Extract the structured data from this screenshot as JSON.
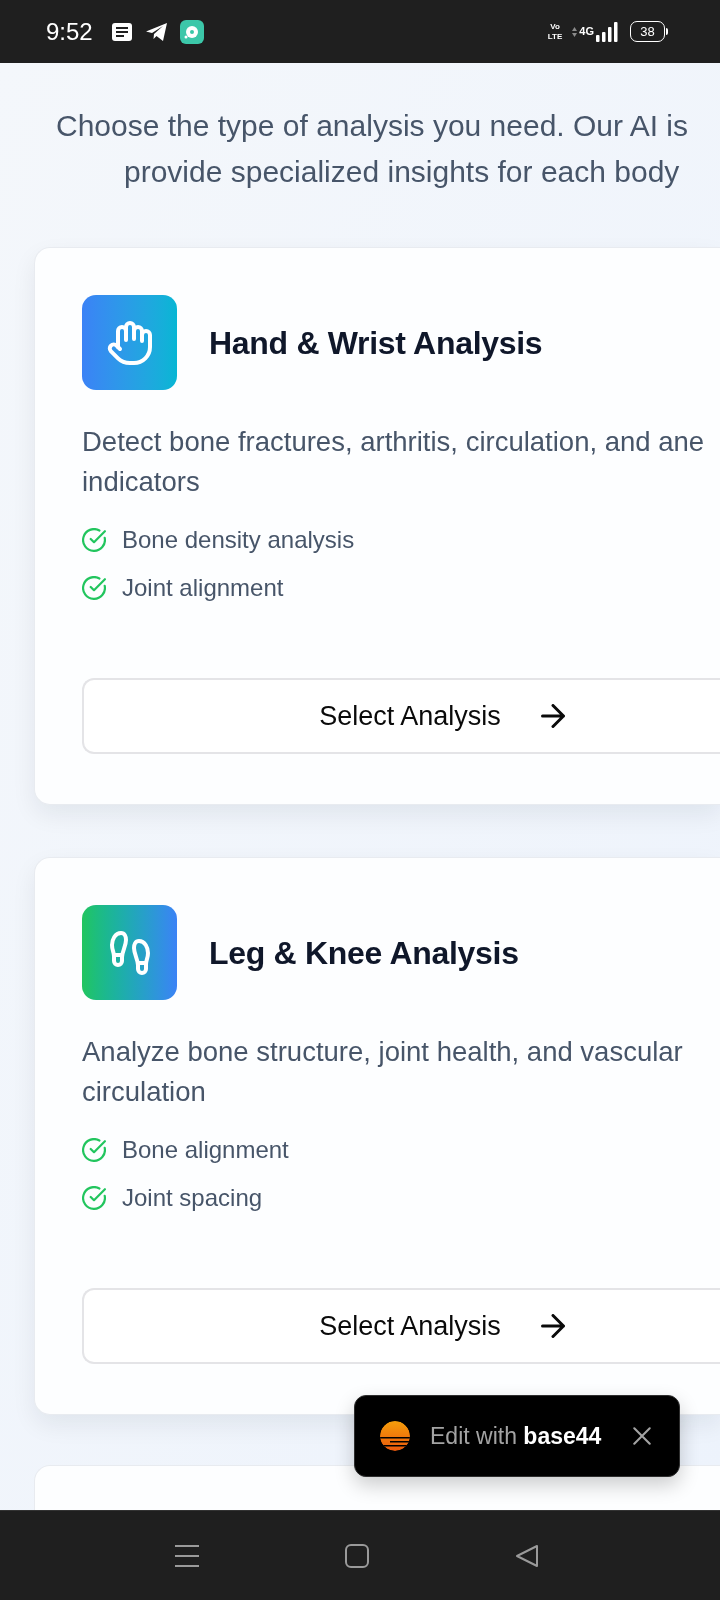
{
  "status_bar": {
    "time": "9:52",
    "volte": [
      "Vo",
      "LTE"
    ],
    "network": "4G",
    "battery": "38"
  },
  "header": {
    "subtitle_lines": [
      "Choose the type of analysis you need. Our AI is",
      "provide specialized insights for each body"
    ]
  },
  "cards": [
    {
      "kind": "hand",
      "title": "Hand & Wrist Analysis",
      "description": "Detect bone fractures, arthritis, circulation, and ane indicators",
      "features": [
        "Bone density analysis",
        "Joint alignment"
      ],
      "button": "Select Analysis"
    },
    {
      "kind": "leg",
      "title": "Leg & Knee Analysis",
      "description": "Analyze bone structure, joint health, and vascular circulation",
      "features": [
        "Bone alignment",
        "Joint spacing"
      ],
      "button": "Select Analysis"
    },
    {
      "kind": "cut_off"
    }
  ],
  "toast": {
    "text": "Edit with **base44**"
  }
}
